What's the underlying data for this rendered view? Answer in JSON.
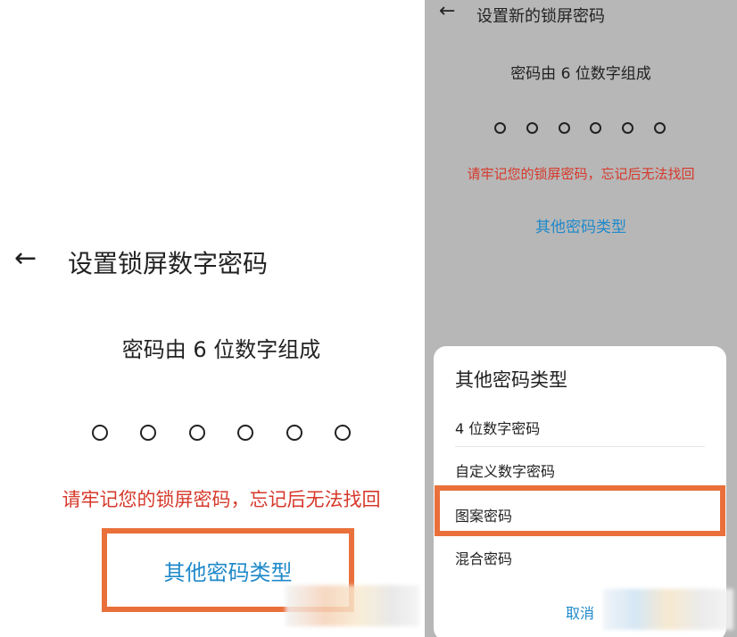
{
  "left_screen": {
    "title": "设置锁屏数字密码",
    "hint": "密码由 6 位数字组成",
    "pin_dots": 6,
    "warning": "请牢记您的锁屏密码，忘记后无法找回",
    "other_types_link": "其他密码类型"
  },
  "right_screen": {
    "title": "设置新的锁屏密码",
    "hint": "密码由 6 位数字组成",
    "pin_dots": 6,
    "warning": "请牢记您的锁屏密码，忘记后无法找回",
    "other_types_link": "其他密码类型",
    "sheet": {
      "title": "其他密码类型",
      "options": [
        "4 位数字密码",
        "自定义数字密码",
        "图案密码",
        "混合密码"
      ],
      "cancel": "取消"
    }
  },
  "colors": {
    "warning": "#d6392b",
    "link": "#1f89c9",
    "highlight": "#e9703b",
    "overlay": "#b7b7b7"
  },
  "icons": {
    "back": "arrow-left-icon"
  }
}
